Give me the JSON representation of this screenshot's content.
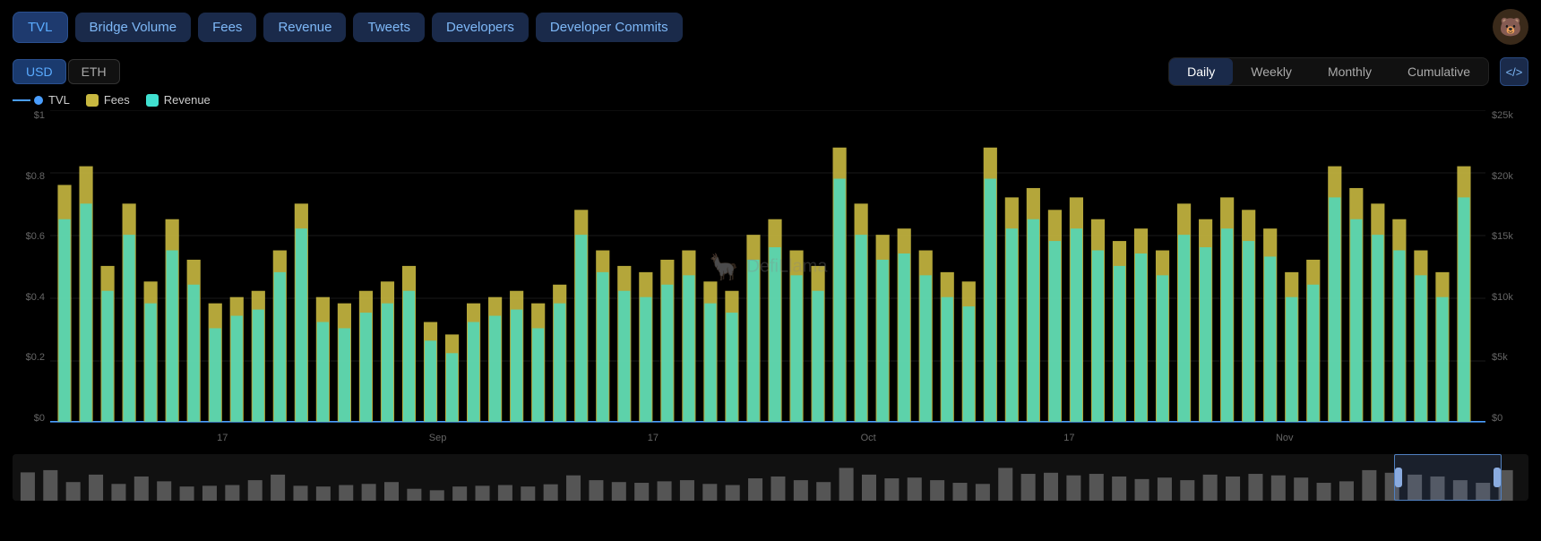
{
  "nav": {
    "buttons": [
      {
        "label": "TVL",
        "active": true
      },
      {
        "label": "Bridge Volume",
        "active": false
      },
      {
        "label": "Fees",
        "active": false
      },
      {
        "label": "Revenue",
        "active": false
      },
      {
        "label": "Tweets",
        "active": false
      },
      {
        "label": "Developers",
        "active": false
      },
      {
        "label": "Developer Commits",
        "active": false
      }
    ],
    "avatar": "🐻"
  },
  "currency": {
    "options": [
      "USD",
      "ETH"
    ],
    "active": "USD"
  },
  "timeframe": {
    "options": [
      "Daily",
      "Weekly",
      "Monthly",
      "Cumulative"
    ],
    "active": "Daily"
  },
  "legend": [
    {
      "key": "tvl",
      "label": "TVL"
    },
    {
      "key": "fees",
      "label": "Fees"
    },
    {
      "key": "revenue",
      "label": "Revenue"
    }
  ],
  "yaxis_left": [
    "$1",
    "$0.8",
    "$0.6",
    "$0.4",
    "$0.2",
    "$0"
  ],
  "yaxis_right": [
    "$25k",
    "$20k",
    "$15k",
    "$10k",
    "$5k",
    "$0"
  ],
  "xaxis_labels": [
    {
      "label": "17",
      "pct": 12
    },
    {
      "label": "Sep",
      "pct": 27
    },
    {
      "label": "17",
      "pct": 42
    },
    {
      "label": "Oct",
      "pct": 56
    },
    {
      "label": "17",
      "pct": 71
    },
    {
      "label": "Nov",
      "pct": 85
    }
  ],
  "watermark": "DefiLlama",
  "code_btn": "</>",
  "chart": {
    "bars": [
      {
        "fees": 76,
        "revenue": 65,
        "x": 1
      },
      {
        "fees": 82,
        "revenue": 70,
        "x": 2.5
      },
      {
        "fees": 50,
        "revenue": 42,
        "x": 4
      },
      {
        "fees": 70,
        "revenue": 60,
        "x": 5.5
      },
      {
        "fees": 45,
        "revenue": 38,
        "x": 7
      },
      {
        "fees": 65,
        "revenue": 55,
        "x": 8.5
      },
      {
        "fees": 52,
        "revenue": 44,
        "x": 10
      },
      {
        "fees": 38,
        "revenue": 30,
        "x": 11.5
      },
      {
        "fees": 40,
        "revenue": 34,
        "x": 13
      },
      {
        "fees": 42,
        "revenue": 36,
        "x": 14.5
      },
      {
        "fees": 55,
        "revenue": 48,
        "x": 16
      },
      {
        "fees": 70,
        "revenue": 62,
        "x": 17.5
      },
      {
        "fees": 40,
        "revenue": 32,
        "x": 19
      },
      {
        "fees": 38,
        "revenue": 30,
        "x": 20.5
      },
      {
        "fees": 42,
        "revenue": 35,
        "x": 22
      },
      {
        "fees": 45,
        "revenue": 38,
        "x": 23.5
      },
      {
        "fees": 50,
        "revenue": 42,
        "x": 25
      },
      {
        "fees": 32,
        "revenue": 26,
        "x": 26.5
      },
      {
        "fees": 28,
        "revenue": 22,
        "x": 28
      },
      {
        "fees": 38,
        "revenue": 32,
        "x": 29.5
      },
      {
        "fees": 40,
        "revenue": 34,
        "x": 31
      },
      {
        "fees": 42,
        "revenue": 36,
        "x": 32.5
      },
      {
        "fees": 38,
        "revenue": 30,
        "x": 34
      },
      {
        "fees": 44,
        "revenue": 38,
        "x": 35.5
      },
      {
        "fees": 68,
        "revenue": 60,
        "x": 37
      },
      {
        "fees": 55,
        "revenue": 48,
        "x": 38.5
      },
      {
        "fees": 50,
        "revenue": 42,
        "x": 40
      },
      {
        "fees": 48,
        "revenue": 40,
        "x": 41.5
      },
      {
        "fees": 52,
        "revenue": 44,
        "x": 43
      },
      {
        "fees": 55,
        "revenue": 47,
        "x": 44.5
      },
      {
        "fees": 45,
        "revenue": 38,
        "x": 46
      },
      {
        "fees": 42,
        "revenue": 35,
        "x": 47.5
      },
      {
        "fees": 60,
        "revenue": 52,
        "x": 49
      },
      {
        "fees": 65,
        "revenue": 56,
        "x": 50.5
      },
      {
        "fees": 55,
        "revenue": 47,
        "x": 52
      },
      {
        "fees": 50,
        "revenue": 42,
        "x": 53.5
      },
      {
        "fees": 88,
        "revenue": 78,
        "x": 55
      },
      {
        "fees": 70,
        "revenue": 60,
        "x": 56.5
      },
      {
        "fees": 60,
        "revenue": 52,
        "x": 58
      },
      {
        "fees": 62,
        "revenue": 54,
        "x": 59.5
      },
      {
        "fees": 55,
        "revenue": 47,
        "x": 61
      },
      {
        "fees": 48,
        "revenue": 40,
        "x": 62.5
      },
      {
        "fees": 45,
        "revenue": 37,
        "x": 64
      },
      {
        "fees": 88,
        "revenue": 78,
        "x": 65.5
      },
      {
        "fees": 72,
        "revenue": 62,
        "x": 67
      },
      {
        "fees": 75,
        "revenue": 65,
        "x": 68.5
      },
      {
        "fees": 68,
        "revenue": 58,
        "x": 70
      },
      {
        "fees": 72,
        "revenue": 62,
        "x": 71.5
      },
      {
        "fees": 65,
        "revenue": 55,
        "x": 73
      },
      {
        "fees": 58,
        "revenue": 50,
        "x": 74.5
      },
      {
        "fees": 62,
        "revenue": 54,
        "x": 76
      },
      {
        "fees": 55,
        "revenue": 47,
        "x": 77.5
      },
      {
        "fees": 70,
        "revenue": 60,
        "x": 79
      },
      {
        "fees": 65,
        "revenue": 56,
        "x": 80.5
      },
      {
        "fees": 72,
        "revenue": 62,
        "x": 82
      },
      {
        "fees": 68,
        "revenue": 58,
        "x": 83.5
      },
      {
        "fees": 62,
        "revenue": 53,
        "x": 85
      },
      {
        "fees": 48,
        "revenue": 40,
        "x": 86.5
      },
      {
        "fees": 52,
        "revenue": 44,
        "x": 88
      },
      {
        "fees": 82,
        "revenue": 72,
        "x": 89.5
      },
      {
        "fees": 75,
        "revenue": 65,
        "x": 91
      },
      {
        "fees": 70,
        "revenue": 60,
        "x": 92.5
      },
      {
        "fees": 65,
        "revenue": 55,
        "x": 94
      },
      {
        "fees": 55,
        "revenue": 47,
        "x": 95.5
      },
      {
        "fees": 48,
        "revenue": 40,
        "x": 97
      },
      {
        "fees": 82,
        "revenue": 72,
        "x": 98.5
      }
    ]
  }
}
